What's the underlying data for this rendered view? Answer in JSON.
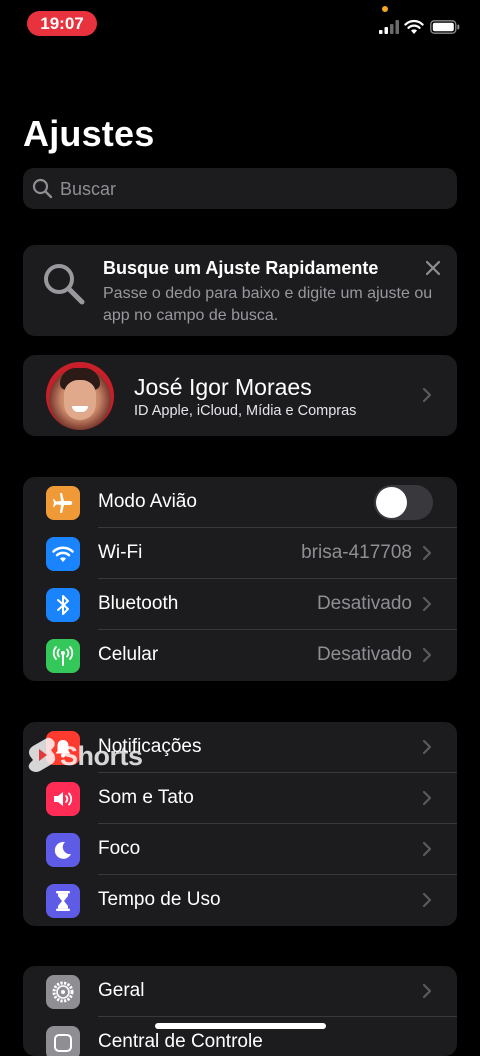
{
  "status_bar": {
    "time": "19:07"
  },
  "title": "Ajustes",
  "search": {
    "placeholder": "Buscar"
  },
  "tip": {
    "title": "Busque um Ajuste Rapidamente",
    "body": "Passe o dedo para baixo e digite um ajuste ou app no campo de busca."
  },
  "profile": {
    "name": "José Igor Moraes",
    "subtitle": "ID Apple, iCloud, Mídia e Compras"
  },
  "group1": [
    {
      "label": "Modo Avião",
      "icon": "airplane-icon",
      "color": "#f09a37",
      "toggle_on": false
    },
    {
      "label": "Wi-Fi",
      "value": "brisa-417708",
      "icon": "wifi-icon",
      "color": "#1a84ff"
    },
    {
      "label": "Bluetooth",
      "value": "Desativado",
      "icon": "bluetooth-icon",
      "color": "#1a84ff"
    },
    {
      "label": "Celular",
      "value": "Desativado",
      "icon": "cellular-icon",
      "color": "#34c759"
    }
  ],
  "group2": [
    {
      "label": "Notificações",
      "icon": "notifications-icon",
      "color": "#ff3b30"
    },
    {
      "label": "Som e Tato",
      "icon": "sound-icon",
      "color": "#ff2d55"
    },
    {
      "label": "Foco",
      "icon": "moon-icon",
      "color": "#5e5ce6"
    },
    {
      "label": "Tempo de Uso",
      "icon": "hourglass-icon",
      "color": "#5e5ce6"
    }
  ],
  "group3": [
    {
      "label": "Geral",
      "icon": "gear-icon",
      "color": "#8e8e93"
    },
    {
      "label": "Central de Controle",
      "icon": "control-center-icon",
      "color": "#8e8e93"
    }
  ],
  "watermark": {
    "text": "Shorts"
  }
}
